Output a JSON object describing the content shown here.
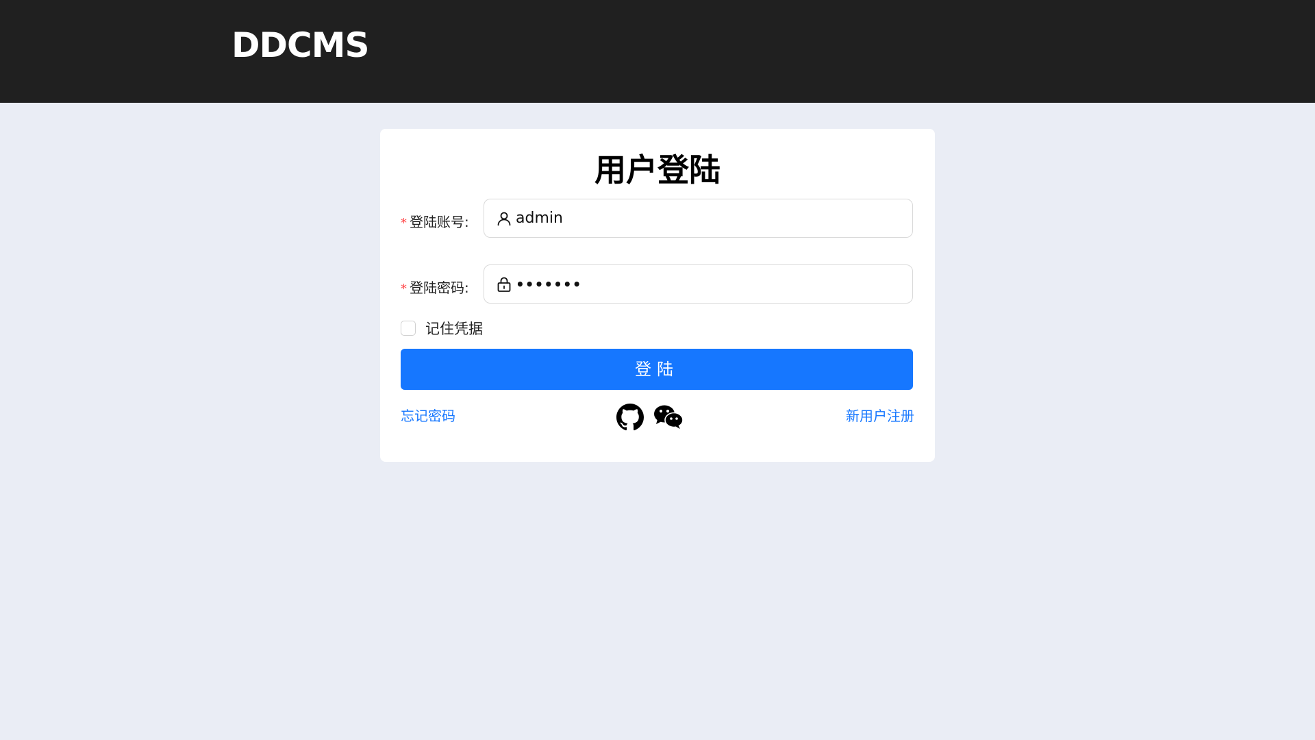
{
  "header": {
    "logo": "DDCMS"
  },
  "login": {
    "title": "用户登陆",
    "account": {
      "required_mark": "*",
      "label": "登陆账号:",
      "value": "admin",
      "icon": "user-icon"
    },
    "password": {
      "required_mark": "*",
      "label": "登陆密码:",
      "value": "•••••••",
      "icon": "lock-icon"
    },
    "remember": {
      "label": "记住凭据",
      "checked": false
    },
    "submit_label": "登陆",
    "forgot_label": "忘记密码",
    "register_label": "新用户注册",
    "social_icons": [
      "github-icon",
      "wechat-icon"
    ]
  },
  "colors": {
    "header_bg": "#202020",
    "page_bg": "#eaedf5",
    "primary": "#1677ff",
    "required": "#ff4d4f"
  }
}
